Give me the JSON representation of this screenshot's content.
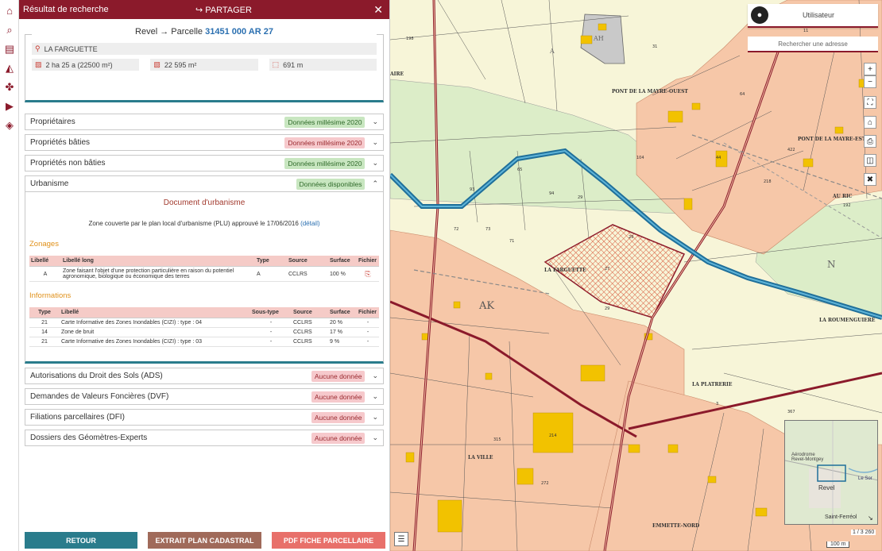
{
  "panel": {
    "title": "Résultat de recherche",
    "share_label": "PARTAGER",
    "parcel": {
      "commune": "Revel",
      "arrow": "→",
      "parcel_word": "Parcelle",
      "ref": "31451 000 AR 27",
      "lieu_dit": "LA FARGUETTE",
      "area": "2 ha 25 a (22500 m²)",
      "surface": "22 595 m²",
      "perimeter": "691 m"
    },
    "accordions": [
      {
        "label": "Propriétaires",
        "badge": "Données millésime 2020",
        "badge_color": "#c8e6c0"
      },
      {
        "label": "Propriétés bâties",
        "badge": "Données millésime 2020",
        "badge_color": "#f6c9cc"
      },
      {
        "label": "Propriétés non bâties",
        "badge": "Données millésime 2020",
        "badge_color": "#c8e6c0"
      },
      {
        "label": "Urbanisme",
        "badge": "Données disponibles",
        "badge_color": "#c8e6c0"
      }
    ],
    "urbanisme": {
      "doc_title": "Document d'urbanisme",
      "doc_text": "Zone couverte par le plan local d'urbanisme (PLU) approuvé le 17/06/2016",
      "doc_link": "(détail)",
      "zonages_title": "Zonages",
      "zonages_headers": [
        "Libellé",
        "Libellé long",
        "Type",
        "Source",
        "Surface",
        "Fichier"
      ],
      "zonages_rows": [
        {
          "libelle": "A",
          "long": "Zone faisant l'objet d'une protection particulière en raison du potentiel agronomique, biologique ou économique des terres",
          "type": "A",
          "source": "CCLRS",
          "surface": "100 %"
        }
      ],
      "info_title": "Informations",
      "info_headers": [
        "Type",
        "Libellé",
        "Sous-type",
        "Source",
        "Surface",
        "Fichier"
      ],
      "info_rows": [
        {
          "type": "21",
          "libelle": "Carte Informative des Zones Inondables (CIZI) : type : 04",
          "sous": "-",
          "source": "CCLRS",
          "surface": "20 %",
          "fichier": "-"
        },
        {
          "type": "14",
          "libelle": "Zone de bruit",
          "sous": "-",
          "source": "CCLRS",
          "surface": "17 %",
          "fichier": "-"
        },
        {
          "type": "21",
          "libelle": "Carte Informative des Zones Inondables (CIZI) : type : 03",
          "sous": "-",
          "source": "CCLRS",
          "surface": "9 %",
          "fichier": "-"
        }
      ]
    },
    "accordions_bottom": [
      {
        "label": "Autorisations du Droit des Sols (ADS)",
        "badge": "Aucune donnée"
      },
      {
        "label": "Demandes de Valeurs Foncières (DVF)",
        "badge": "Aucune donnée"
      },
      {
        "label": "Filiations parcellaires (DFI)",
        "badge": "Aucune donnée"
      },
      {
        "label": "Dossiers des Géomètres-Experts",
        "badge": "Aucune donnée"
      }
    ],
    "buttons": {
      "back": "RETOUR",
      "extract": "EXTRAIT PLAN CADASTRAL",
      "pdf": "PDF FICHE PARCELLAIRE"
    }
  },
  "map": {
    "user_label": "Utilisateur",
    "address_placeholder": "Rechercher une adresse",
    "zoom_in": "+",
    "zoom_out": "−",
    "page_indicator": "1 / 3 260",
    "scale": "100 m",
    "labels": {
      "pont_mayre_ouest": "PONT DE LA MAYRE-OUEST",
      "pont_mayre_est": "PONT DE LA MAYRE-EST",
      "au_ric": "AU RIC",
      "la_farguette": "LA FARGUETTE",
      "la_platrerie": "LA PLATRERIE",
      "la_roumenguiere": "LA ROUMENGUIERE",
      "la_ville": "LA VILLE",
      "ahk": "AK",
      "n": "N",
      "a": "A",
      "ah": "AH",
      "emmette_nord": "EMMETTE-NORD",
      "aire": "AIRE"
    },
    "overview": {
      "revel": "Revel",
      "aerodrome": "Aérodrome\nRevel-Montgey",
      "saint_ferreol": "Saint-Ferréol",
      "le_sor": "Le Sor"
    }
  },
  "colors": {
    "brand": "#8b1a2b",
    "teal": "#2a7c8c",
    "btn_back": "#2a7c8c",
    "btn_extract": "#a06a5a",
    "btn_pdf": "#e8706a"
  }
}
